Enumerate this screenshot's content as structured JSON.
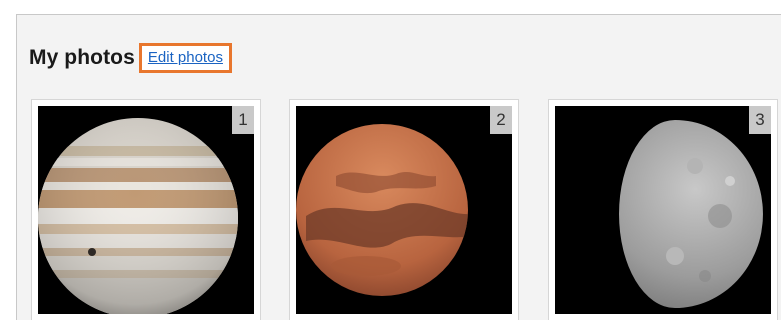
{
  "section": {
    "title": "My photos",
    "edit_link": "Edit photos"
  },
  "photos": [
    {
      "number": "1",
      "icon": "jupiter-photo"
    },
    {
      "number": "2",
      "icon": "mars-photo"
    },
    {
      "number": "3",
      "icon": "moon-photo"
    }
  ],
  "colors": {
    "highlight": "#e8762d",
    "link": "#1a63c2",
    "panel_bg": "#f3f3f3"
  }
}
